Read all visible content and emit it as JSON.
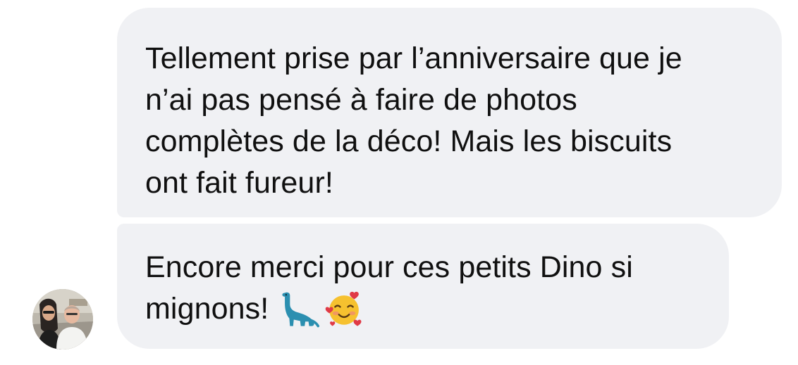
{
  "conversation": {
    "messages": [
      {
        "lines": [
          "Tellement prise par l’anniversaire que je",
          "n’ai pas pensé à faire de photos",
          "complètes de la déco! Mais les biscuits",
          "ont fait fureur!"
        ]
      },
      {
        "lines": [
          "Encore merci pour ces petits Dino si",
          "mignons!"
        ],
        "emoji": [
          "sauropod-emoji",
          "smiling-face-with-hearts-emoji"
        ]
      }
    ]
  },
  "avatar": {
    "alt": "profile photo"
  },
  "colors": {
    "bubble_background": "#f0f1f4",
    "text": "#101010",
    "dino": "#2b8fb0",
    "emoji_face": "#f6c12f",
    "heart": "#e03a46"
  }
}
